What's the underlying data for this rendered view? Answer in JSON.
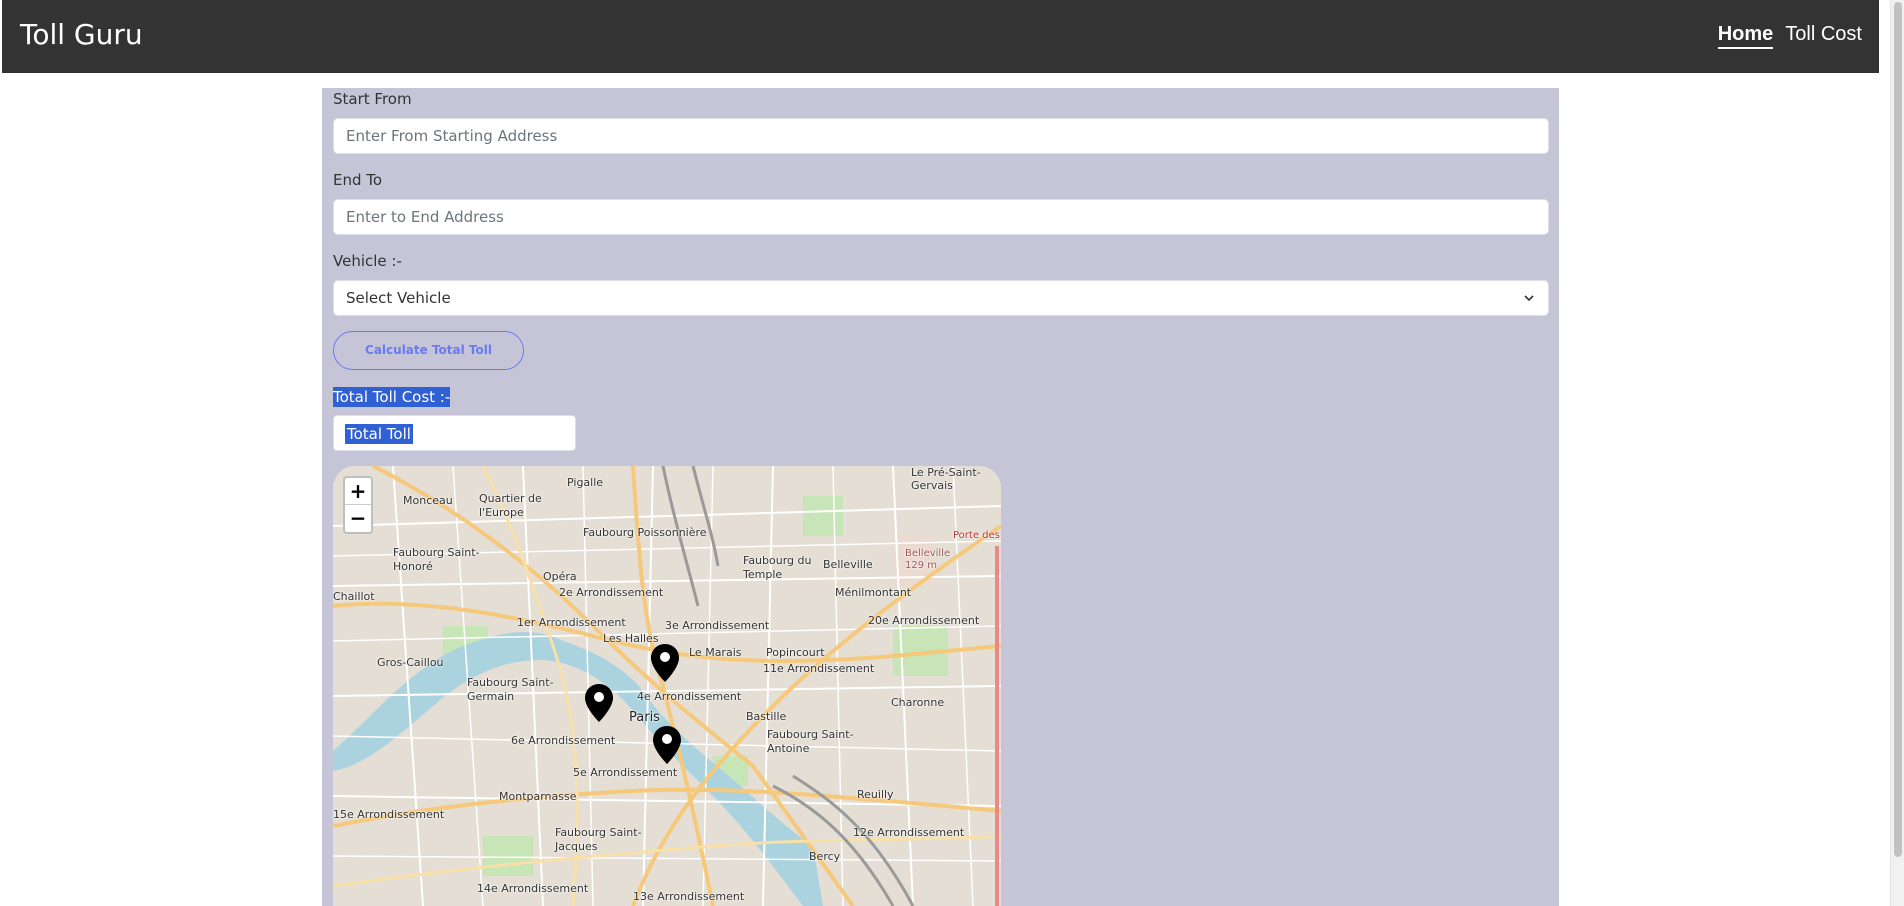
{
  "header": {
    "brand": "Toll Guru",
    "nav": [
      {
        "label": "Home",
        "active": true
      },
      {
        "label": "Toll Cost",
        "active": false
      }
    ]
  },
  "form": {
    "start_label": "Start From",
    "start_placeholder": "Enter From Starting Address",
    "end_label": "End To",
    "end_placeholder": "Enter to End Address",
    "vehicle_label": "Vehicle :-",
    "vehicle_selected": "Select Vehicle",
    "calculate_button": "Calculate Total Toll",
    "total_label": "Total Toll Cost :-",
    "total_value": "Total Toll"
  },
  "map": {
    "zoom_in": "+",
    "zoom_out": "−",
    "labels": [
      "Pigalle",
      "Monceau",
      "Quartier de l'Europe",
      "Faubourg Poissonnière",
      "Faubourg Saint-Honoré",
      "Opéra",
      "2e Arrondissement",
      "Faubourg du Temple",
      "Belleville",
      "Ménilmontant",
      "Chaillot",
      "1er Arrondissement",
      "Les Halles",
      "3e Arrondissement",
      "Le Marais",
      "Popincourt",
      "11e Arrondissement",
      "20e Arrondissement",
      "Gros-Caillou",
      "Faubourg Saint-Germain",
      "4e Arrondissement",
      "Paris",
      "Bastille",
      "Charonne",
      "6e Arrondissement",
      "Faubourg Saint-Antoine",
      "5e Arrondissement",
      "Montparnasse",
      "Reuilly",
      "15e Arrondissement",
      "Faubourg Saint-Jacques",
      "12e Arrondissement",
      "Bercy",
      "14e Arrondissement",
      "13e Arrondissement",
      "Belleville 129 m",
      "Porte des Lilas",
      "Le Pré-Saint-Gervais"
    ],
    "colors": {
      "water": "#aad3df",
      "park": "#c8e5b7",
      "road_major": "#f6c87a",
      "road_minor": "#ffffff",
      "marker": "#000000"
    }
  },
  "colors": {
    "navbar": "#333333",
    "panel": "#c6c5d8",
    "button_accent": "#6b7af0",
    "selection": "#2f60d4"
  }
}
